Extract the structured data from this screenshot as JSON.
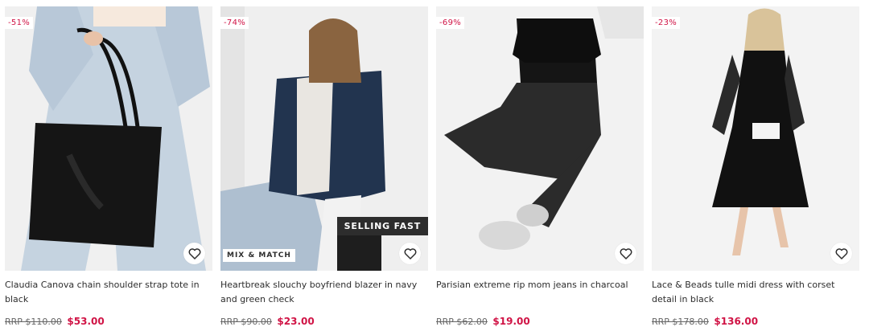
{
  "products": [
    {
      "discount": "-51%",
      "title": "Claudia Canova chain shoulder strap tote in black",
      "rrp": "RRP $110.00",
      "price": "$53.00"
    },
    {
      "discount": "-74%",
      "title": "Heartbreak slouchy boyfriend blazer in navy and green check",
      "rrp": "RRP $90.00",
      "price": "$23.00",
      "badge_mix": "MIX & MATCH",
      "badge_selling": "SELLING FAST"
    },
    {
      "discount": "-69%",
      "title": "Parisian extreme rip mom jeans in charcoal",
      "rrp": "RRP $62.00",
      "price": "$19.00"
    },
    {
      "discount": "-23%",
      "title": "Lace & Beads tulle midi dress with corset detail in black",
      "rrp": "RRP $178.00",
      "price": "$136.00"
    }
  ],
  "colors": {
    "sale": "#d01345",
    "text": "#2d2d2d",
    "image_bg": "#f1f1f1"
  },
  "icons": {
    "favourite": "heart-outline-icon"
  }
}
